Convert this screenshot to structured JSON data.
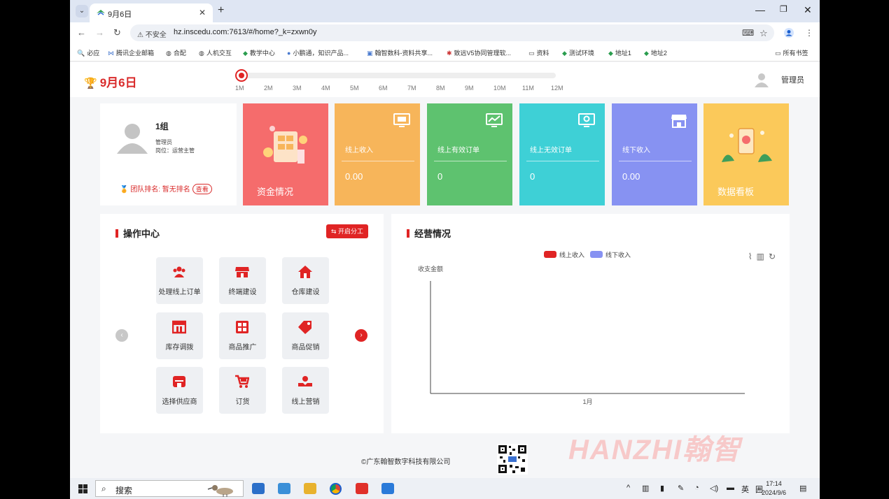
{
  "browser": {
    "tab_title": "9月6日",
    "new_tab": "+",
    "url": "hz.inscedu.com:7613/#/home?_k=zxwn0y",
    "security": "不安全",
    "bookmarks": [
      "必应",
      "腾讯企业邮箱",
      "合配",
      "人机交互",
      "教学中心",
      "小鹏通，知识产品...",
      "翰智数科-资料共享...",
      "致远V5协同管理软...",
      "资料",
      "测试环境",
      "地址1",
      "地址2"
    ],
    "all_bookmarks": "所有书签"
  },
  "header": {
    "brand": "9月6日",
    "months": [
      "1M",
      "2M",
      "3M",
      "4M",
      "5M",
      "6M",
      "7M",
      "8M",
      "9M",
      "10M",
      "11M",
      "12M"
    ],
    "user": "管理员"
  },
  "profile": {
    "group": "1组",
    "role": "管理员",
    "post": "岗位：运营主管",
    "rank": "团队排名: 暂无排名",
    "view": "查看"
  },
  "cards": [
    {
      "title": "资金情况",
      "color": "#f56c6c"
    },
    {
      "name": "线上收入",
      "value": "0.00",
      "color": "#f7b55a"
    },
    {
      "name": "线上有效订单",
      "value": "0",
      "color": "#5ec26f"
    },
    {
      "name": "线上无效订单",
      "value": "0",
      "color": "#3ed0d6"
    },
    {
      "name": "线下收入",
      "value": "0.00",
      "color": "#8792f2"
    },
    {
      "title": "数据看板",
      "color": "#fbc95a"
    }
  ],
  "ops": {
    "title": "操作中心",
    "button": "开启分工",
    "items": [
      "处理线上订单",
      "终端建设",
      "仓库建设",
      "库存调拨",
      "商品推广",
      "商品促销",
      "选择供应商",
      "订货",
      "线上营销"
    ]
  },
  "business": {
    "title": "经营情况"
  },
  "chart_data": {
    "type": "bar",
    "categories": [
      "1月"
    ],
    "series": [
      {
        "name": "线上收入",
        "values": [
          0
        ],
        "color": "#e02424"
      },
      {
        "name": "线下收入",
        "values": [
          0
        ],
        "color": "#8792f2"
      }
    ],
    "ylabel": "收支金额",
    "legend": "top-center"
  },
  "footer": {
    "copyright": "©广东翰智数字科技有限公司",
    "watermark": "HANZHI翰智"
  },
  "taskbar": {
    "search": "搜索",
    "ime": "英",
    "time": "17:14",
    "date": "2024/9/6"
  }
}
